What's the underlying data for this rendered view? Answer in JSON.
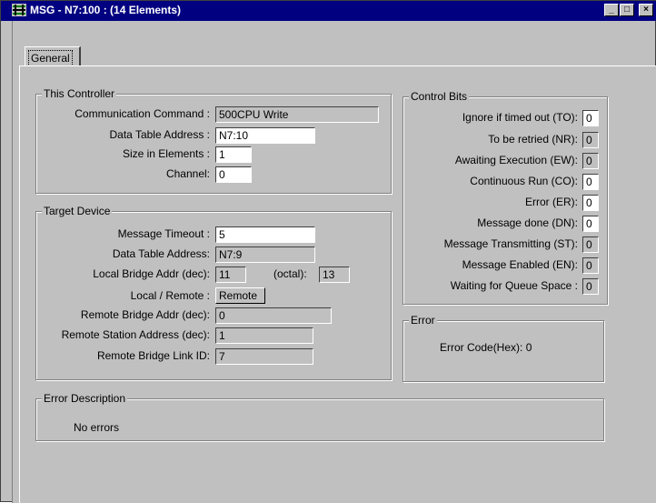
{
  "window": {
    "title": "MSG - N7:100 : (14 Elements)",
    "controls": {
      "minimize": "_",
      "maximize": "□",
      "close": "×"
    }
  },
  "tabs": [
    {
      "label": "General",
      "selected": true
    }
  ],
  "this_controller": {
    "title": "This Controller",
    "rows": [
      {
        "label": "Communication Command :",
        "value": "500CPU Write"
      },
      {
        "label": "Data Table Address :",
        "value": "N7:10"
      },
      {
        "label": "Size in Elements :",
        "value": "1"
      },
      {
        "label": "Channel:",
        "value": "0"
      }
    ]
  },
  "target_device": {
    "title": "Target Device",
    "rows": [
      {
        "label": "Message Timeout :",
        "value": "5"
      },
      {
        "label": "Data Table Address:",
        "value": "N7:9"
      },
      {
        "label": "Local Bridge Addr (dec):",
        "value": "11"
      },
      {
        "label": "Local / Remote :",
        "value": "Remote"
      },
      {
        "label": "Remote Bridge Addr (dec):",
        "value": "0"
      },
      {
        "label": "Remote Station Address (dec):",
        "value": "1"
      },
      {
        "label": "Remote Bridge Link ID:",
        "value": "7"
      }
    ],
    "octal_label": "(octal):",
    "octal_value": "13"
  },
  "control_bits": {
    "title": "Control Bits",
    "rows": [
      {
        "label": "Ignore if timed out (TO):",
        "value": "0"
      },
      {
        "label": "To be retried (NR):",
        "value": "0"
      },
      {
        "label": "Awaiting Execution (EW):",
        "value": "0"
      },
      {
        "label": "Continuous Run (CO):",
        "value": "0"
      },
      {
        "label": "Error (ER):",
        "value": "0"
      },
      {
        "label": "Message done (DN):",
        "value": "0"
      },
      {
        "label": "Message Transmitting (ST):",
        "value": "0"
      },
      {
        "label": "Message Enabled (EN):",
        "value": "0"
      },
      {
        "label": "Waiting for Queue Space :",
        "value": "0"
      }
    ]
  },
  "error": {
    "title": "Error",
    "code_text": "Error Code(Hex): 0"
  },
  "error_description": {
    "title": "Error Description",
    "text": "No errors"
  }
}
